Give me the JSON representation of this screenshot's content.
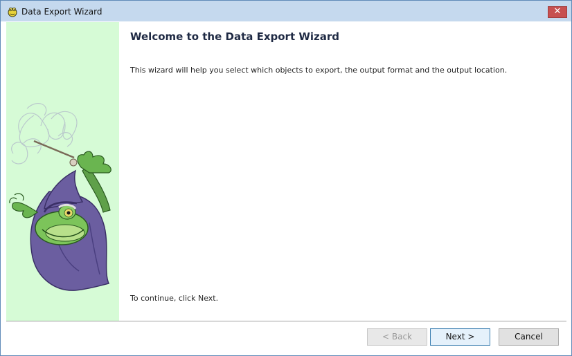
{
  "window": {
    "title": "Data Export Wizard",
    "close_label": "✕",
    "icon": "frog-app-icon"
  },
  "side_panel": {
    "image": "wizard-frog-illustration",
    "background": "#d6fbd6"
  },
  "content": {
    "heading": "Welcome to the Data Export Wizard",
    "intro": "This wizard will help you select which objects to export, the output format and the output location.",
    "continue_text": "To continue, click Next."
  },
  "buttons": {
    "back_label": "< Back",
    "back_enabled": false,
    "next_label": "Next >",
    "cancel_label": "Cancel"
  },
  "colors": {
    "titlebar": "#c5d9ee",
    "close": "#c75050",
    "panel": "#d6fbd6"
  }
}
